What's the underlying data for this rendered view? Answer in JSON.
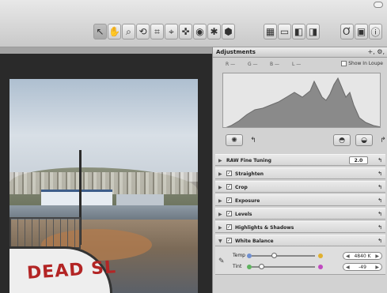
{
  "toolbar": {
    "tools_left": [
      {
        "icon": "select-arrow-icon",
        "glyph": "↖",
        "selected": true
      },
      {
        "icon": "pan-hand-icon",
        "glyph": "✋",
        "selected": false
      },
      {
        "icon": "zoom-glass-icon",
        "glyph": "⌕",
        "selected": false
      },
      {
        "icon": "rotate-icon",
        "glyph": "⟲",
        "selected": false
      },
      {
        "icon": "crop-icon",
        "glyph": "⌗",
        "selected": false
      },
      {
        "icon": "straighten-icon",
        "glyph": "⌖",
        "selected": false
      },
      {
        "icon": "lift-stamp-icon",
        "glyph": "✜",
        "selected": false
      },
      {
        "icon": "red-eye-icon",
        "glyph": "◉",
        "selected": false
      },
      {
        "icon": "spot-patch-icon",
        "glyph": "✱",
        "selected": false
      },
      {
        "icon": "lift-icon",
        "glyph": "⬢",
        "selected": false
      }
    ],
    "tools_mid": [
      {
        "icon": "view-grid-icon",
        "glyph": "▦"
      },
      {
        "icon": "view-filmstrip-icon",
        "glyph": "▭"
      },
      {
        "icon": "view-single-icon",
        "glyph": "◧"
      },
      {
        "icon": "view-dual-icon",
        "glyph": "◨"
      }
    ],
    "tools_right": [
      {
        "icon": "loupe-icon",
        "glyph": "Ơ"
      },
      {
        "icon": "browser-icon",
        "glyph": "▣"
      },
      {
        "icon": "info-icon",
        "glyph": "ⓘ"
      }
    ]
  },
  "inspector": {
    "title": "Adjustments",
    "actions": "+,  ⚙,",
    "channels": [
      "R —",
      "G —",
      "B —",
      "L —"
    ],
    "show_in_loupe": "Show In Loupe",
    "bricks": [
      {
        "label": "RAW Fine Tuning",
        "check": false,
        "version": "2.0"
      },
      {
        "label": "Straighten",
        "check": true
      },
      {
        "label": "Crop",
        "check": true
      },
      {
        "label": "Exposure",
        "check": true
      },
      {
        "label": "Levels",
        "check": true
      },
      {
        "label": "Highlights & Shadows",
        "check": true
      },
      {
        "label": "White Balance",
        "check": true
      }
    ],
    "white_balance": {
      "temp_label": "Temp",
      "temp_value": "4840 K",
      "temp_level": 0.35,
      "tint_label": "Tint",
      "tint_value": "-49",
      "tint_level": 0.15
    }
  },
  "photo": {
    "sign_text": "DEAD SL"
  }
}
